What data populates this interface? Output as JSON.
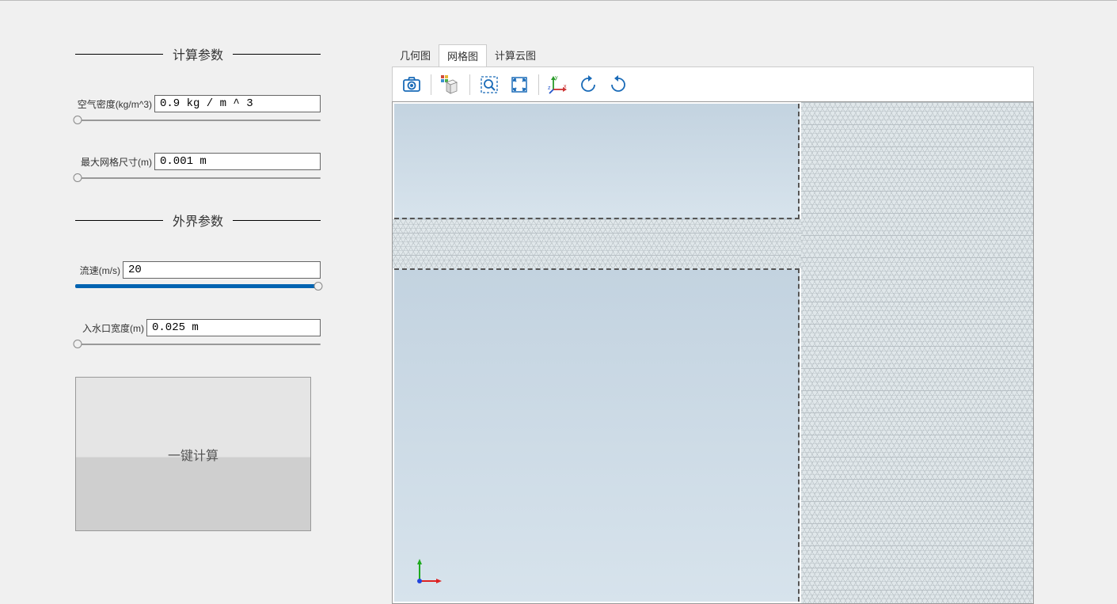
{
  "sections": {
    "calc_params_title": "计算参数",
    "external_params_title": "外界参数"
  },
  "params": {
    "air_density": {
      "label": "空气密度(kg/m^3)",
      "value": "0.9 kg / m ^ 3",
      "slider_percent": 1
    },
    "max_mesh": {
      "label": "最大网格尺寸(m)",
      "value": "0.001 m",
      "slider_percent": 1
    },
    "flow_speed": {
      "label": "流速(m/s)",
      "value": "20",
      "slider_percent": 99
    },
    "inlet_width": {
      "label": "入水口宽度(m)",
      "value": "0.025 m",
      "slider_percent": 1
    }
  },
  "compute_button_label": "一键计算",
  "tabs": {
    "geometry": "几何图",
    "mesh": "网格图",
    "results": "计算云图"
  },
  "toolbar_icons": {
    "screenshot": "screenshot-icon",
    "cube": "cube-view-icon",
    "zoom_box": "zoom-box-icon",
    "zoom_extents": "zoom-extents-icon",
    "axes": "axes-icon",
    "rotate_ccw": "rotate-ccw-icon",
    "rotate_cw": "rotate-cw-icon"
  }
}
